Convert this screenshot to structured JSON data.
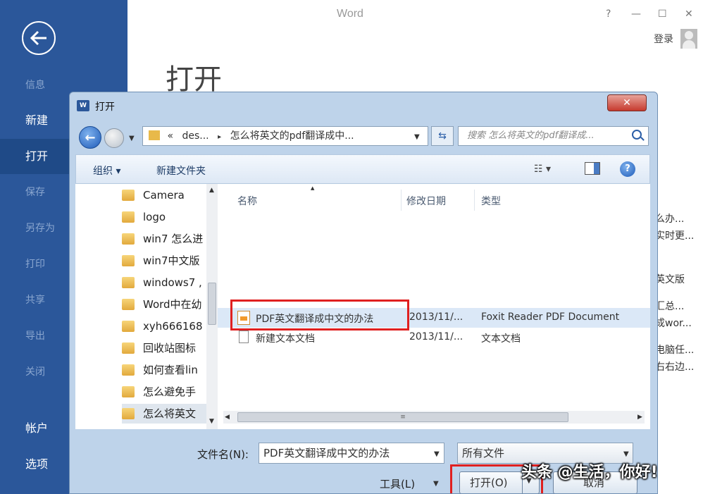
{
  "app": {
    "title": "Word",
    "window_controls": [
      "?",
      "—",
      "☐",
      "✕"
    ],
    "login_label": "登录",
    "page_heading": "打开"
  },
  "sidebar": {
    "items": [
      {
        "label": "信息",
        "state": "dim"
      },
      {
        "label": "新建",
        "state": "normal"
      },
      {
        "label": "打开",
        "state": "active"
      },
      {
        "label": "保存",
        "state": "dim"
      },
      {
        "label": "另存为",
        "state": "dim"
      },
      {
        "label": "打印",
        "state": "dim"
      },
      {
        "label": "共享",
        "state": "dim"
      },
      {
        "label": "导出",
        "state": "dim"
      },
      {
        "label": "关闭",
        "state": "dim"
      },
      {
        "label": "帐户",
        "state": "normal"
      },
      {
        "label": "选项",
        "state": "normal"
      }
    ]
  },
  "recent_snippets": [
    "么办...",
    "实时更...",
    "英文版",
    "汇总...",
    "成wor...",
    "电脑任...",
    "右右边..."
  ],
  "dialog": {
    "title": "打开",
    "close_label": "✕",
    "address": {
      "prefix": "«",
      "crumb1": "des...",
      "separator": "▸",
      "crumb2": "怎么将英文的pdf翻译成中..."
    },
    "search_placeholder": "搜索 怎么将英文的pdf翻译成...",
    "toolbar": {
      "organize": "组织 ▾",
      "new_folder": "新建文件夹",
      "views": "☷ ▾",
      "help": "?"
    },
    "tree": {
      "items": [
        "Camera",
        "logo",
        "win7 怎么进",
        "win7中文版",
        "windows7 ,",
        "Word中在幼",
        "xyh666168",
        "回收站图标",
        "如何查看lin",
        "怎么避免手",
        "怎么将英文"
      ],
      "selected_index": 10
    },
    "columns": {
      "name": "名称",
      "date": "修改日期",
      "type": "类型"
    },
    "files": [
      {
        "name": "PDF英文翻译成中文的办法",
        "date": "2013/11/...",
        "type": "Foxit Reader PDF Document",
        "icon": "pdf-file-icon"
      },
      {
        "name": "新建文本文档",
        "date": "2013/11/...",
        "type": "文本文档",
        "icon": "text-file-icon"
      }
    ],
    "filename_label": "文件名(N):",
    "filename_value": "PDF英文翻译成中文的办法",
    "filetype_value": "所有文件",
    "tools_label": "工具(L)",
    "open_label": "打开(O)",
    "cancel_label": "取消"
  },
  "watermark": "头条 @生活，你好!",
  "colors": {
    "sidebar": "#2b579a",
    "sidebar_active": "#1f4a87",
    "highlight_box": "#e02020",
    "selection": "#dbe8f7"
  }
}
